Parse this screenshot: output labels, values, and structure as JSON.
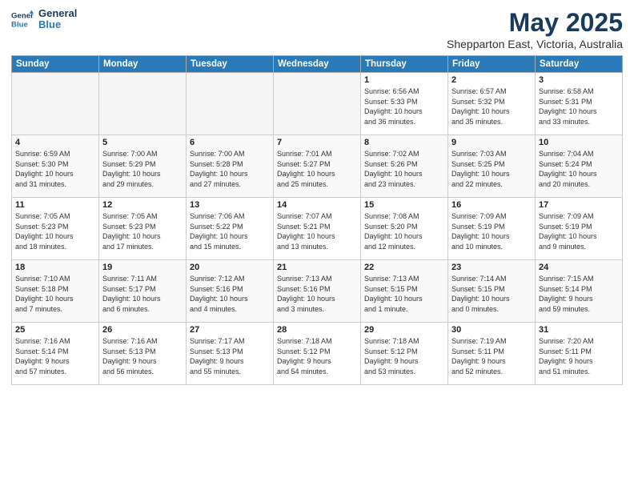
{
  "header": {
    "logo_line1": "General",
    "logo_line2": "Blue",
    "title": "May 2025",
    "subtitle": "Shepparton East, Victoria, Australia"
  },
  "days_of_week": [
    "Sunday",
    "Monday",
    "Tuesday",
    "Wednesday",
    "Thursday",
    "Friday",
    "Saturday"
  ],
  "weeks": [
    [
      {
        "day": "",
        "info": ""
      },
      {
        "day": "",
        "info": ""
      },
      {
        "day": "",
        "info": ""
      },
      {
        "day": "",
        "info": ""
      },
      {
        "day": "1",
        "info": "Sunrise: 6:56 AM\nSunset: 5:33 PM\nDaylight: 10 hours\nand 36 minutes."
      },
      {
        "day": "2",
        "info": "Sunrise: 6:57 AM\nSunset: 5:32 PM\nDaylight: 10 hours\nand 35 minutes."
      },
      {
        "day": "3",
        "info": "Sunrise: 6:58 AM\nSunset: 5:31 PM\nDaylight: 10 hours\nand 33 minutes."
      }
    ],
    [
      {
        "day": "4",
        "info": "Sunrise: 6:59 AM\nSunset: 5:30 PM\nDaylight: 10 hours\nand 31 minutes."
      },
      {
        "day": "5",
        "info": "Sunrise: 7:00 AM\nSunset: 5:29 PM\nDaylight: 10 hours\nand 29 minutes."
      },
      {
        "day": "6",
        "info": "Sunrise: 7:00 AM\nSunset: 5:28 PM\nDaylight: 10 hours\nand 27 minutes."
      },
      {
        "day": "7",
        "info": "Sunrise: 7:01 AM\nSunset: 5:27 PM\nDaylight: 10 hours\nand 25 minutes."
      },
      {
        "day": "8",
        "info": "Sunrise: 7:02 AM\nSunset: 5:26 PM\nDaylight: 10 hours\nand 23 minutes."
      },
      {
        "day": "9",
        "info": "Sunrise: 7:03 AM\nSunset: 5:25 PM\nDaylight: 10 hours\nand 22 minutes."
      },
      {
        "day": "10",
        "info": "Sunrise: 7:04 AM\nSunset: 5:24 PM\nDaylight: 10 hours\nand 20 minutes."
      }
    ],
    [
      {
        "day": "11",
        "info": "Sunrise: 7:05 AM\nSunset: 5:23 PM\nDaylight: 10 hours\nand 18 minutes."
      },
      {
        "day": "12",
        "info": "Sunrise: 7:05 AM\nSunset: 5:23 PM\nDaylight: 10 hours\nand 17 minutes."
      },
      {
        "day": "13",
        "info": "Sunrise: 7:06 AM\nSunset: 5:22 PM\nDaylight: 10 hours\nand 15 minutes."
      },
      {
        "day": "14",
        "info": "Sunrise: 7:07 AM\nSunset: 5:21 PM\nDaylight: 10 hours\nand 13 minutes."
      },
      {
        "day": "15",
        "info": "Sunrise: 7:08 AM\nSunset: 5:20 PM\nDaylight: 10 hours\nand 12 minutes."
      },
      {
        "day": "16",
        "info": "Sunrise: 7:09 AM\nSunset: 5:19 PM\nDaylight: 10 hours\nand 10 minutes."
      },
      {
        "day": "17",
        "info": "Sunrise: 7:09 AM\nSunset: 5:19 PM\nDaylight: 10 hours\nand 9 minutes."
      }
    ],
    [
      {
        "day": "18",
        "info": "Sunrise: 7:10 AM\nSunset: 5:18 PM\nDaylight: 10 hours\nand 7 minutes."
      },
      {
        "day": "19",
        "info": "Sunrise: 7:11 AM\nSunset: 5:17 PM\nDaylight: 10 hours\nand 6 minutes."
      },
      {
        "day": "20",
        "info": "Sunrise: 7:12 AM\nSunset: 5:16 PM\nDaylight: 10 hours\nand 4 minutes."
      },
      {
        "day": "21",
        "info": "Sunrise: 7:13 AM\nSunset: 5:16 PM\nDaylight: 10 hours\nand 3 minutes."
      },
      {
        "day": "22",
        "info": "Sunrise: 7:13 AM\nSunset: 5:15 PM\nDaylight: 10 hours\nand 1 minute."
      },
      {
        "day": "23",
        "info": "Sunrise: 7:14 AM\nSunset: 5:15 PM\nDaylight: 10 hours\nand 0 minutes."
      },
      {
        "day": "24",
        "info": "Sunrise: 7:15 AM\nSunset: 5:14 PM\nDaylight: 9 hours\nand 59 minutes."
      }
    ],
    [
      {
        "day": "25",
        "info": "Sunrise: 7:16 AM\nSunset: 5:14 PM\nDaylight: 9 hours\nand 57 minutes."
      },
      {
        "day": "26",
        "info": "Sunrise: 7:16 AM\nSunset: 5:13 PM\nDaylight: 9 hours\nand 56 minutes."
      },
      {
        "day": "27",
        "info": "Sunrise: 7:17 AM\nSunset: 5:13 PM\nDaylight: 9 hours\nand 55 minutes."
      },
      {
        "day": "28",
        "info": "Sunrise: 7:18 AM\nSunset: 5:12 PM\nDaylight: 9 hours\nand 54 minutes."
      },
      {
        "day": "29",
        "info": "Sunrise: 7:18 AM\nSunset: 5:12 PM\nDaylight: 9 hours\nand 53 minutes."
      },
      {
        "day": "30",
        "info": "Sunrise: 7:19 AM\nSunset: 5:11 PM\nDaylight: 9 hours\nand 52 minutes."
      },
      {
        "day": "31",
        "info": "Sunrise: 7:20 AM\nSunset: 5:11 PM\nDaylight: 9 hours\nand 51 minutes."
      }
    ]
  ]
}
